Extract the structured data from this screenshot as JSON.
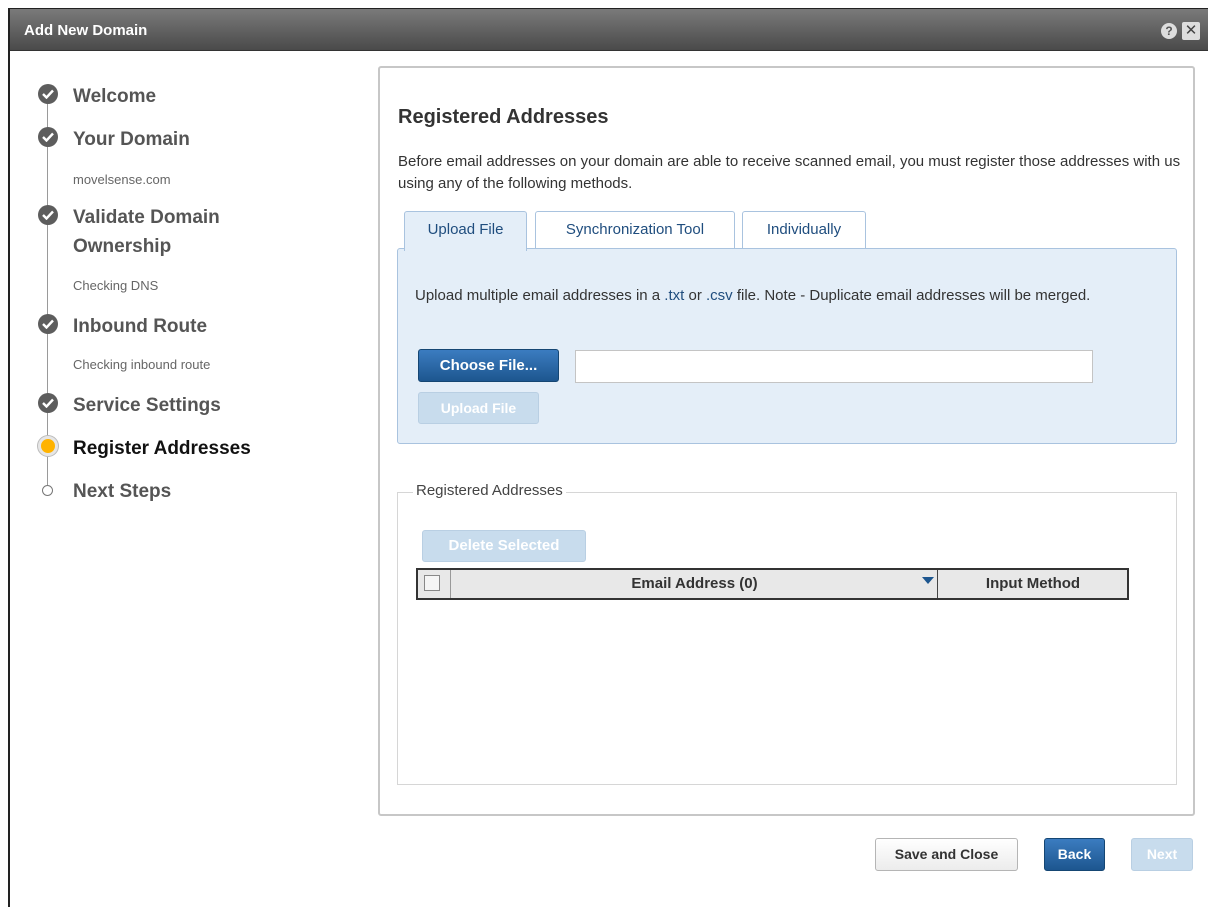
{
  "dialog": {
    "title": "Add New Domain",
    "help_glyph": "?",
    "close_glyph": "✕"
  },
  "steps": [
    {
      "label": "Welcome",
      "status": "done"
    },
    {
      "label": "Your Domain",
      "status": "done",
      "sub": "movelsense.com"
    },
    {
      "label": "Validate Domain",
      "label2": "Ownership",
      "status": "done",
      "sub": "Checking DNS"
    },
    {
      "label": "Inbound Route",
      "status": "done",
      "sub": "Checking inbound route"
    },
    {
      "label": "Service Settings",
      "status": "done"
    },
    {
      "label": "Register Addresses",
      "status": "current"
    },
    {
      "label": "Next Steps",
      "status": "future"
    }
  ],
  "main": {
    "heading": "Registered Addresses",
    "description": "Before email addresses on your domain are able to receive scanned email, you must register those addresses with us using any of the following methods.",
    "tabs": [
      {
        "label": "Upload File",
        "active": true
      },
      {
        "label": "Synchronization Tool",
        "active": false
      },
      {
        "label": "Individually",
        "active": false
      }
    ],
    "upload": {
      "text_before": "Upload multiple email addresses in a ",
      "ext_txt": ".txt",
      "text_or": " or ",
      "ext_csv": ".csv",
      "text_after": " file. Note - Duplicate email addresses will be merged.",
      "choose_label": "Choose File...",
      "file_value": "",
      "upload_label": "Upload File"
    },
    "registered": {
      "legend": "Registered Addresses",
      "delete_label": "Delete Selected",
      "columns": {
        "email": "Email Address (0)",
        "method": "Input Method"
      },
      "rows": []
    }
  },
  "footer": {
    "save_close": "Save and Close",
    "back": "Back",
    "next": "Next"
  },
  "colors": {
    "primary": "#1d568f",
    "accent_current_step": "#ffb300",
    "tab_panel_bg": "#e4eef8"
  }
}
